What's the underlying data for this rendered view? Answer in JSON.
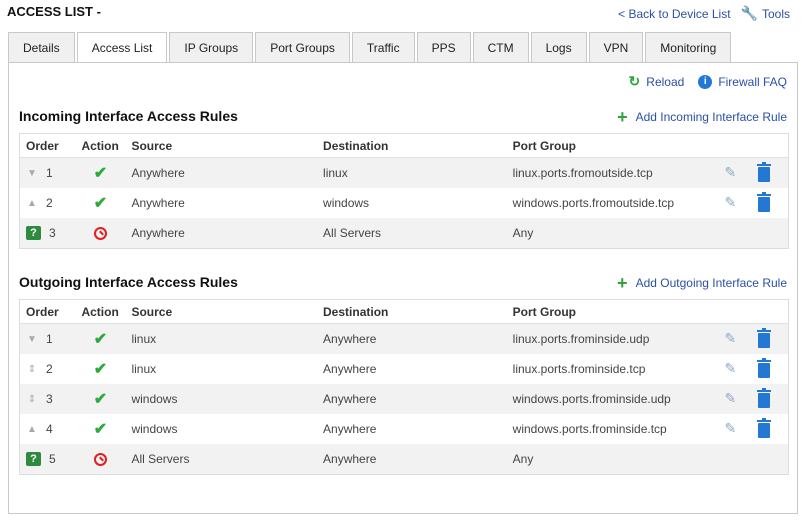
{
  "page_title": "ACCESS LIST -",
  "top_links": {
    "back": "< Back to Device List",
    "tools": "Tools"
  },
  "tabs": [
    {
      "label": "Details",
      "active": false
    },
    {
      "label": "Access List",
      "active": true
    },
    {
      "label": "IP Groups",
      "active": false
    },
    {
      "label": "Port Groups",
      "active": false
    },
    {
      "label": "Traffic",
      "active": false
    },
    {
      "label": "PPS",
      "active": false
    },
    {
      "label": "CTM",
      "active": false
    },
    {
      "label": "Logs",
      "active": false
    },
    {
      "label": "VPN",
      "active": false
    },
    {
      "label": "Monitoring",
      "active": false
    }
  ],
  "panel_actions": {
    "reload": "Reload",
    "faq": "Firewall FAQ"
  },
  "incoming": {
    "title": "Incoming Interface Access Rules",
    "add_label": "Add Incoming Interface Rule",
    "headers": [
      "Order",
      "Action",
      "Source",
      "Destination",
      "Port Group"
    ],
    "rows": [
      {
        "order": "1",
        "move": "down",
        "action": "allow",
        "source": "Anywhere",
        "source_link": false,
        "destination": "linux",
        "destination_link": true,
        "port_group": "linux.ports.fromoutside.tcp",
        "port_link": true,
        "editable": true
      },
      {
        "order": "2",
        "move": "up",
        "action": "allow",
        "source": "Anywhere",
        "source_link": false,
        "destination": "windows",
        "destination_link": true,
        "port_group": "windows.ports.fromoutside.tcp",
        "port_link": true,
        "editable": true
      },
      {
        "order": "3",
        "move": "default",
        "action": "deny",
        "source": "Anywhere",
        "source_link": false,
        "destination": "All Servers",
        "destination_link": false,
        "port_group": "Any",
        "port_link": false,
        "editable": false
      }
    ]
  },
  "outgoing": {
    "title": "Outgoing Interface Access Rules",
    "add_label": "Add Outgoing Interface Rule",
    "headers": [
      "Order",
      "Action",
      "Source",
      "Destination",
      "Port Group"
    ],
    "rows": [
      {
        "order": "1",
        "move": "down",
        "action": "allow",
        "source": "linux",
        "source_link": true,
        "destination": "Anywhere",
        "destination_link": false,
        "port_group": "linux.ports.frominside.udp",
        "port_link": true,
        "editable": true
      },
      {
        "order": "2",
        "move": "both",
        "action": "allow",
        "source": "linux",
        "source_link": true,
        "destination": "Anywhere",
        "destination_link": false,
        "port_group": "linux.ports.frominside.tcp",
        "port_link": true,
        "editable": true
      },
      {
        "order": "3",
        "move": "both",
        "action": "allow",
        "source": "windows",
        "source_link": true,
        "destination": "Anywhere",
        "destination_link": false,
        "port_group": "windows.ports.frominside.udp",
        "port_link": true,
        "editable": true
      },
      {
        "order": "4",
        "move": "up",
        "action": "allow",
        "source": "windows",
        "source_link": true,
        "destination": "Anywhere",
        "destination_link": false,
        "port_group": "windows.ports.frominside.tcp",
        "port_link": true,
        "editable": true
      },
      {
        "order": "5",
        "move": "default",
        "action": "deny",
        "source": "All Servers",
        "source_link": false,
        "destination": "Anywhere",
        "destination_link": false,
        "port_group": "Any",
        "port_link": false,
        "editable": false
      }
    ]
  },
  "colors": {
    "link": "#2b4fa8",
    "allow": "#2eaa3b",
    "deny": "#e02020",
    "trash": "#2378d3",
    "help_badge": "#2e8b3e"
  }
}
